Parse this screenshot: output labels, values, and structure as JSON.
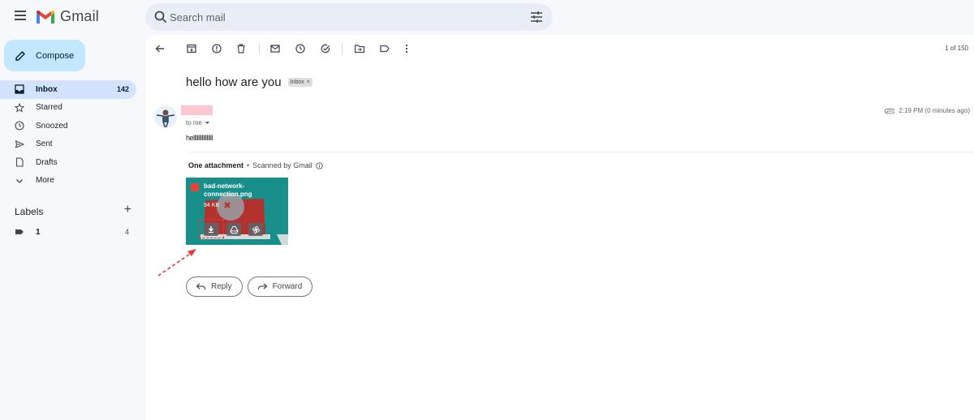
{
  "header": {
    "app_name": "Gmail",
    "search_placeholder": "Search mail"
  },
  "sidebar": {
    "compose_label": "Compose",
    "items": [
      {
        "label": "Inbox",
        "count": "142",
        "icon": "inbox-icon",
        "active": true
      },
      {
        "label": "Starred",
        "count": "",
        "icon": "star-icon",
        "active": false
      },
      {
        "label": "Snoozed",
        "count": "",
        "icon": "clock-icon",
        "active": false
      },
      {
        "label": "Sent",
        "count": "",
        "icon": "send-icon",
        "active": false
      },
      {
        "label": "Drafts",
        "count": "",
        "icon": "draft-icon",
        "active": false
      },
      {
        "label": "More",
        "count": "",
        "icon": "chevron-down-icon",
        "active": false
      }
    ],
    "labels_title": "Labels",
    "labels": [
      {
        "name": "1",
        "count": "4"
      }
    ]
  },
  "toolbar": {
    "pager": "1 of 150"
  },
  "message": {
    "subject": "hello how are you",
    "label_chip": "Inbox",
    "recipient": "to me",
    "time": "2:19 PM (0 minutes ago)",
    "body": "hellllllllllllllll"
  },
  "attachments": {
    "header": "One attachment",
    "separator": "•",
    "scan_note": "Scanned by Gmail",
    "file_name": "bad-network-connection.png",
    "file_size": "94 KB"
  },
  "actions": {
    "reply": "Reply",
    "forward": "Forward"
  },
  "colors": {
    "accent": "#c2e7ff",
    "active_nav": "#d3e3fd",
    "attachment_bg": "#188f8a",
    "annotation": "#e53935"
  }
}
